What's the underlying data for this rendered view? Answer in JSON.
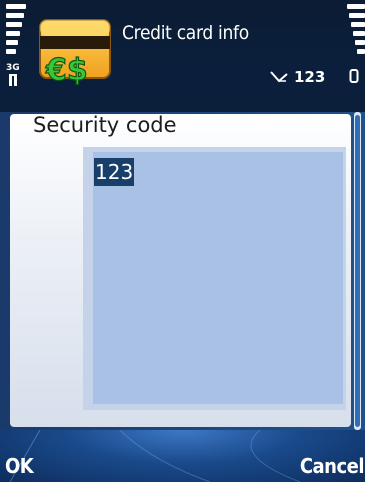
{
  "status": {
    "network": "3G",
    "indicator_value": "123"
  },
  "app": {
    "title": "Credit card info",
    "icon_text": "€$"
  },
  "form": {
    "label": "Security code",
    "value": "123"
  },
  "softkeys": {
    "left": "OK",
    "right": "Cancel"
  },
  "colors": {
    "header_bg": "#0b1f3c",
    "panel_bg": "#ecf0f6",
    "field_bg": "#a9c1e4",
    "selection_bg": "#173f6a",
    "softkey_bg": "#1a4a8b"
  },
  "icons": {
    "signal": "signal-strength-icon",
    "battery": "battery-level-icon",
    "pen": "pen-input-icon",
    "lock": "keypad-lock-icon"
  }
}
